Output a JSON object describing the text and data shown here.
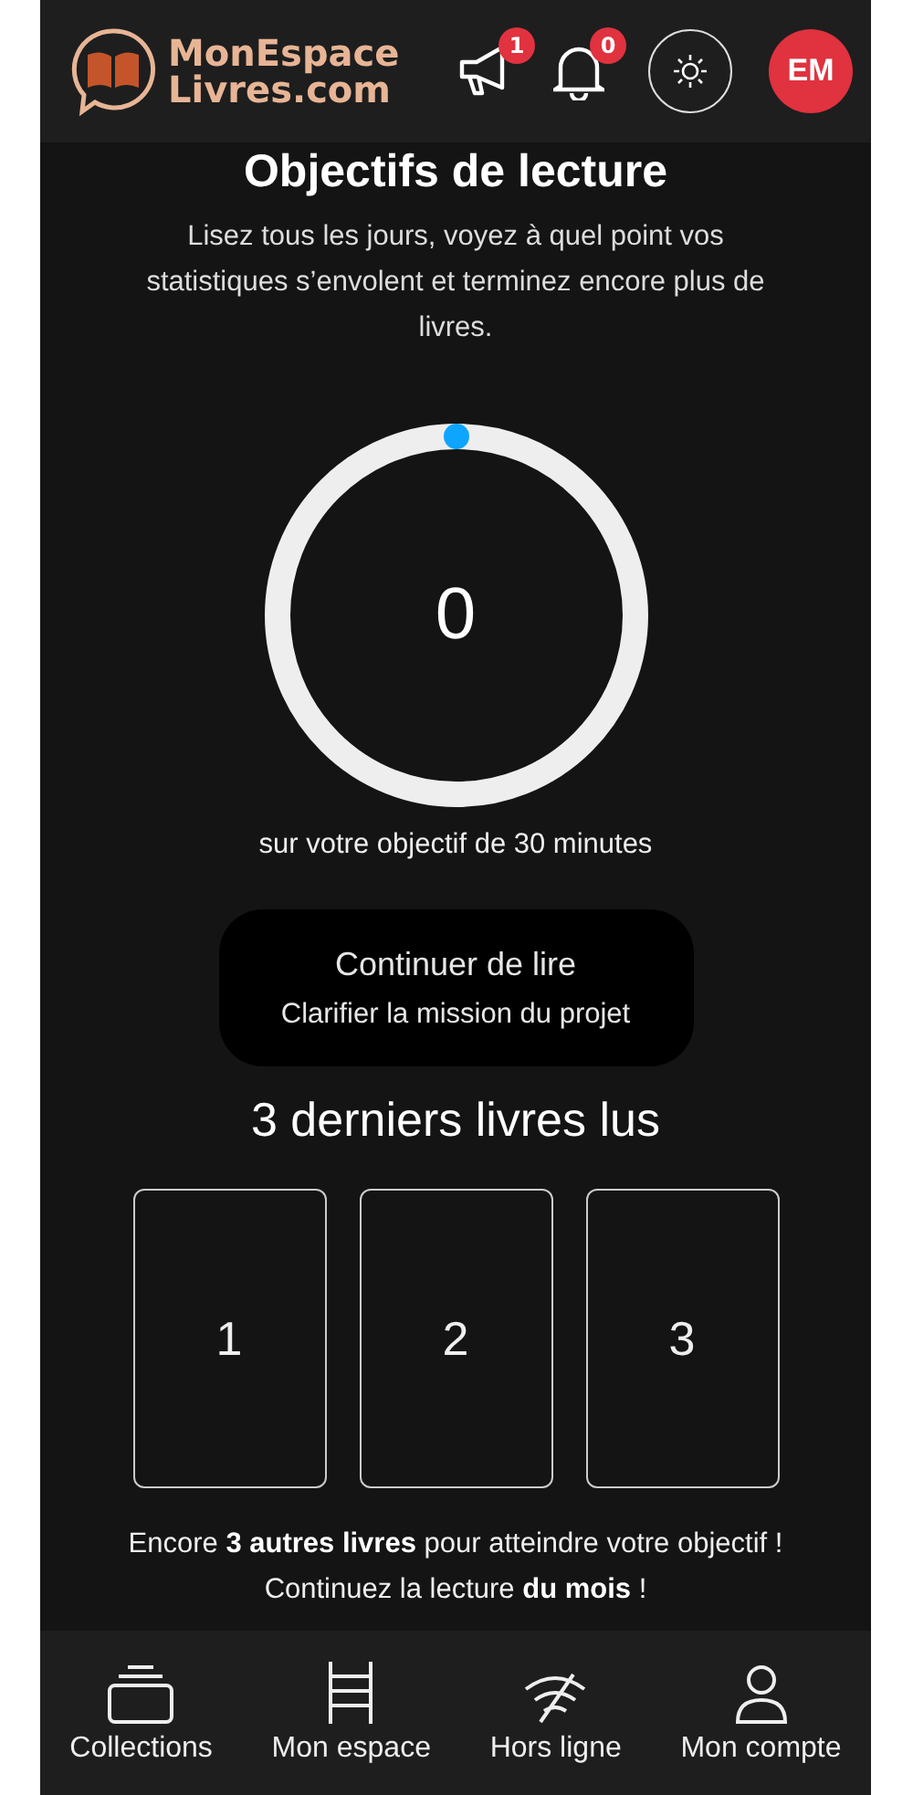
{
  "header": {
    "logo": {
      "line1": "MonEspace",
      "line2": "Livres.com"
    },
    "announcements": {
      "count": "1"
    },
    "notifications": {
      "count": "0"
    },
    "avatar": "EM"
  },
  "goal": {
    "title": "Objectifs de lecture",
    "subtitle": "Lisez tous les jours, voyez à quel point vos statistiques s’envolent et terminez encore plus de livres.",
    "value": "0",
    "caption": "sur votre objectif de 30 minutes"
  },
  "continue_button": {
    "label": "Continuer de lire",
    "sublabel": "Clarifier la mission du projet"
  },
  "recent": {
    "title": "3 derniers livres lus",
    "books": [
      "1",
      "2",
      "3"
    ]
  },
  "footer_lines": [
    "Encore **3 autres livres** pour atteindre votre objectif !",
    "Continuez la lecture **du mois** !"
  ],
  "nav": [
    {
      "kind": "collections",
      "label": "Collections",
      "selected": false
    },
    {
      "kind": "space",
      "label": "Mon espace",
      "selected": false
    },
    {
      "kind": "offline",
      "label": "Hors ligne",
      "selected": false
    },
    {
      "kind": "account",
      "label": "Mon compte",
      "selected": false
    }
  ]
}
